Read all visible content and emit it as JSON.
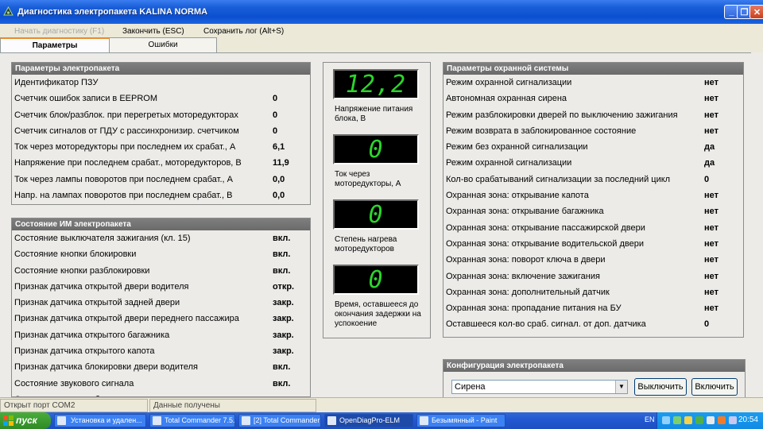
{
  "window": {
    "title": "Диагностика электропакета KALINA NORMA",
    "minimize": "_",
    "restore": "❐",
    "close": "✕"
  },
  "menu": [
    {
      "label": "Начать диагностику (F1)",
      "disabled": true
    },
    {
      "label": "Закончить (ESC)",
      "disabled": false
    },
    {
      "label": "Сохранить лог (Alt+S)",
      "disabled": false
    }
  ],
  "tabs": [
    {
      "label": "Параметры",
      "active": true
    },
    {
      "label": "Ошибки",
      "active": false
    }
  ],
  "params_panel": {
    "title": "Параметры электропакета",
    "rows": [
      {
        "label": "Идентификатор ПЗУ",
        "value": ""
      },
      {
        "label": "Счетчик ошибок записи в EEPROM",
        "value": "0"
      },
      {
        "label": "Счетчик блок/разблок. при перегретых моторедукторах",
        "value": "0"
      },
      {
        "label": "Счетчик сигналов от ПДУ с рассинхронизир. счетчиком",
        "value": "0"
      },
      {
        "label": "Ток через моторедукторы при последнем их срабат., А",
        "value": "6,1"
      },
      {
        "label": "Напряжение при последнем срабат., моторедукторов, В",
        "value": "11,9"
      },
      {
        "label": "Ток через лампы поворотов при последнем срабат., А",
        "value": "0,0"
      },
      {
        "label": "Напр. на лампах поворотов при последнем срабат., В",
        "value": "0,0"
      }
    ]
  },
  "im_panel": {
    "title": "Состояние ИМ электропакета",
    "rows": [
      {
        "label": "Состояние выключателя зажигания (кл. 15)",
        "value": "вкл."
      },
      {
        "label": "Состояние кнопки блокировки",
        "value": "вкл."
      },
      {
        "label": "Состояние кнопки разблокировки",
        "value": "вкл."
      },
      {
        "label": "Признак датчика открытой двери водителя",
        "value": "откр."
      },
      {
        "label": "Признак датчика открытой задней двери",
        "value": "закр."
      },
      {
        "label": "Признак датчика открытой двери переднего пассажира",
        "value": "закр."
      },
      {
        "label": "Признак датчика открытого багажника",
        "value": "закр."
      },
      {
        "label": "Признак датчика открытого капота",
        "value": "закр."
      },
      {
        "label": "Признак датчика блокировки двери водителя",
        "value": "вкл."
      },
      {
        "label": "Состояние звукового сигнала",
        "value": "вкл."
      },
      {
        "label": "Состояние кнопки обогрева заднего стекла",
        "value": "выкл."
      }
    ]
  },
  "indicators": [
    {
      "display": "12,2",
      "caption": "Напряжение питания блока, В"
    },
    {
      "display": "0",
      "caption": "Ток через моторедукторы, А"
    },
    {
      "display": "0",
      "caption": "Степень нагрева моторедукторов"
    },
    {
      "display": "0",
      "caption": "Время, оставшееся до окончания задержки на успокоение"
    }
  ],
  "security_panel": {
    "title": "Параметры охранной системы",
    "rows": [
      {
        "label": "Режим охранной сигнализации",
        "value": "нет"
      },
      {
        "label": "Автономная охранная сирена",
        "value": "нет"
      },
      {
        "label": "Режим разблокировки дверей по выключению зажигания",
        "value": "нет"
      },
      {
        "label": "Режим возврата в заблокированное состояние",
        "value": "нет"
      },
      {
        "label": "Режим без охранной сигнализации",
        "value": "да"
      },
      {
        "label": "Режим охранной сигнализации",
        "value": "да"
      },
      {
        "label": "Кол-во срабатываний сигнализации за последний цикл",
        "value": "0"
      },
      {
        "label": "Охранная зона: открывание капота",
        "value": "нет"
      },
      {
        "label": "Охранная зона: открывание багажника",
        "value": "нет"
      },
      {
        "label": "Охранная зона: открывание пассажирской двери",
        "value": "нет"
      },
      {
        "label": "Охранная зона: открывание водительской двери",
        "value": "нет"
      },
      {
        "label": "Охранная зона: поворот ключа в двери",
        "value": "нет"
      },
      {
        "label": "Охранная зона: включение зажигания",
        "value": "нет"
      },
      {
        "label": "Охранная зона: дополнительный датчик",
        "value": "нет"
      },
      {
        "label": "Охранная зона: пропадание питания на БУ",
        "value": "нет"
      },
      {
        "label": "Оставшееся кол-во сраб. сигнал. от доп. датчика",
        "value": "0"
      }
    ]
  },
  "config_panel": {
    "title": "Конфигурация электропакета",
    "select_value": "Сирена",
    "btn_off": "Выключить",
    "btn_on": "Включить"
  },
  "statusbar": {
    "left": "Открыт порт COM2",
    "right": "Данные получены"
  },
  "taskbar": {
    "start": "пуск",
    "tasks": [
      {
        "label": "Установка и удален...",
        "active": false
      },
      {
        "label": "Total Commander 7.5...",
        "active": false
      },
      {
        "label": "[2] Total Commander ...",
        "active": false
      },
      {
        "label": "OpenDiagPro-ELM",
        "active": true
      },
      {
        "label": "Безымянный - Paint",
        "active": false
      }
    ],
    "lang": "EN",
    "clock": "20:54"
  },
  "colors": {
    "lcd_green": "#2bd62b",
    "header_gray": "#737373",
    "titlebar_blue": "#0b4fd0"
  }
}
